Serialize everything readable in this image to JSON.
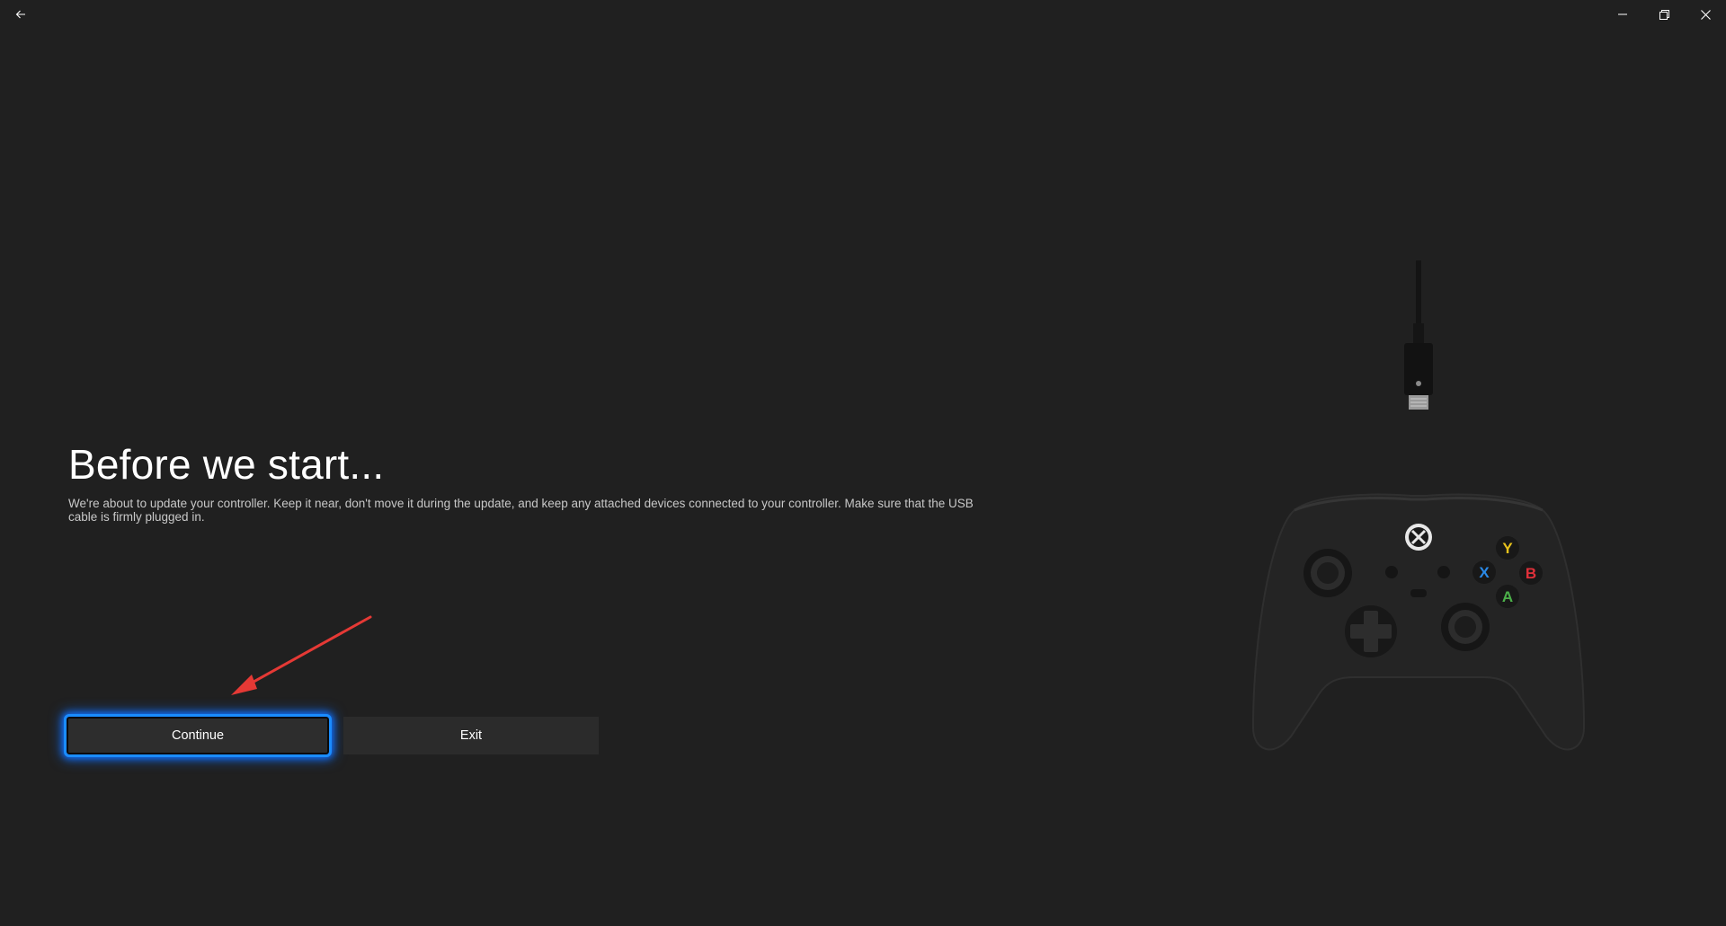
{
  "titlebar": {
    "back_icon": "arrow-left-icon",
    "minimize_icon": "minimize-icon",
    "restore_icon": "restore-icon",
    "close_icon": "close-icon"
  },
  "main": {
    "title": "Before we start...",
    "description": "We're about to update your controller. Keep it near, don't move it during the update, and keep any attached devices connected to your controller. Make sure that the USB cable is firmly plugged in.",
    "continue_label": "Continue",
    "exit_label": "Exit"
  },
  "annotation": {
    "arrow_color": "#e53935"
  },
  "illustration": {
    "controller": "xbox-controller-icon",
    "cable": "usb-c-cable-icon",
    "buttons": {
      "y": "Y",
      "x": "X",
      "b": "B",
      "a": "A"
    },
    "button_colors": {
      "y": "#e8c21c",
      "x": "#2a8ae8",
      "b": "#e0303a",
      "a": "#4cb04a"
    }
  }
}
